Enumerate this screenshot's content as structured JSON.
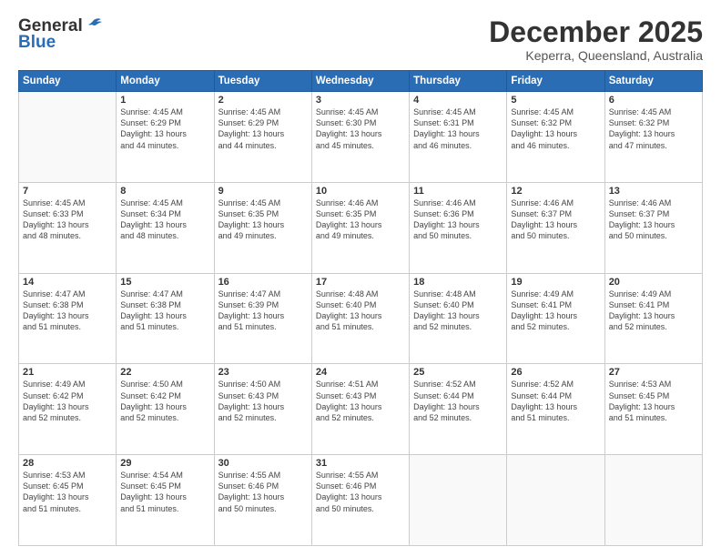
{
  "logo": {
    "line1": "General",
    "line2": "Blue"
  },
  "header": {
    "month": "December 2025",
    "location": "Keperra, Queensland, Australia"
  },
  "days_of_week": [
    "Sunday",
    "Monday",
    "Tuesday",
    "Wednesday",
    "Thursday",
    "Friday",
    "Saturday"
  ],
  "weeks": [
    [
      {
        "day": "",
        "info": ""
      },
      {
        "day": "1",
        "info": "Sunrise: 4:45 AM\nSunset: 6:29 PM\nDaylight: 13 hours\nand 44 minutes."
      },
      {
        "day": "2",
        "info": "Sunrise: 4:45 AM\nSunset: 6:29 PM\nDaylight: 13 hours\nand 44 minutes."
      },
      {
        "day": "3",
        "info": "Sunrise: 4:45 AM\nSunset: 6:30 PM\nDaylight: 13 hours\nand 45 minutes."
      },
      {
        "day": "4",
        "info": "Sunrise: 4:45 AM\nSunset: 6:31 PM\nDaylight: 13 hours\nand 46 minutes."
      },
      {
        "day": "5",
        "info": "Sunrise: 4:45 AM\nSunset: 6:32 PM\nDaylight: 13 hours\nand 46 minutes."
      },
      {
        "day": "6",
        "info": "Sunrise: 4:45 AM\nSunset: 6:32 PM\nDaylight: 13 hours\nand 47 minutes."
      }
    ],
    [
      {
        "day": "7",
        "info": "Sunrise: 4:45 AM\nSunset: 6:33 PM\nDaylight: 13 hours\nand 48 minutes."
      },
      {
        "day": "8",
        "info": "Sunrise: 4:45 AM\nSunset: 6:34 PM\nDaylight: 13 hours\nand 48 minutes."
      },
      {
        "day": "9",
        "info": "Sunrise: 4:45 AM\nSunset: 6:35 PM\nDaylight: 13 hours\nand 49 minutes."
      },
      {
        "day": "10",
        "info": "Sunrise: 4:46 AM\nSunset: 6:35 PM\nDaylight: 13 hours\nand 49 minutes."
      },
      {
        "day": "11",
        "info": "Sunrise: 4:46 AM\nSunset: 6:36 PM\nDaylight: 13 hours\nand 50 minutes."
      },
      {
        "day": "12",
        "info": "Sunrise: 4:46 AM\nSunset: 6:37 PM\nDaylight: 13 hours\nand 50 minutes."
      },
      {
        "day": "13",
        "info": "Sunrise: 4:46 AM\nSunset: 6:37 PM\nDaylight: 13 hours\nand 50 minutes."
      }
    ],
    [
      {
        "day": "14",
        "info": "Sunrise: 4:47 AM\nSunset: 6:38 PM\nDaylight: 13 hours\nand 51 minutes."
      },
      {
        "day": "15",
        "info": "Sunrise: 4:47 AM\nSunset: 6:38 PM\nDaylight: 13 hours\nand 51 minutes."
      },
      {
        "day": "16",
        "info": "Sunrise: 4:47 AM\nSunset: 6:39 PM\nDaylight: 13 hours\nand 51 minutes."
      },
      {
        "day": "17",
        "info": "Sunrise: 4:48 AM\nSunset: 6:40 PM\nDaylight: 13 hours\nand 51 minutes."
      },
      {
        "day": "18",
        "info": "Sunrise: 4:48 AM\nSunset: 6:40 PM\nDaylight: 13 hours\nand 52 minutes."
      },
      {
        "day": "19",
        "info": "Sunrise: 4:49 AM\nSunset: 6:41 PM\nDaylight: 13 hours\nand 52 minutes."
      },
      {
        "day": "20",
        "info": "Sunrise: 4:49 AM\nSunset: 6:41 PM\nDaylight: 13 hours\nand 52 minutes."
      }
    ],
    [
      {
        "day": "21",
        "info": "Sunrise: 4:49 AM\nSunset: 6:42 PM\nDaylight: 13 hours\nand 52 minutes."
      },
      {
        "day": "22",
        "info": "Sunrise: 4:50 AM\nSunset: 6:42 PM\nDaylight: 13 hours\nand 52 minutes."
      },
      {
        "day": "23",
        "info": "Sunrise: 4:50 AM\nSunset: 6:43 PM\nDaylight: 13 hours\nand 52 minutes."
      },
      {
        "day": "24",
        "info": "Sunrise: 4:51 AM\nSunset: 6:43 PM\nDaylight: 13 hours\nand 52 minutes."
      },
      {
        "day": "25",
        "info": "Sunrise: 4:52 AM\nSunset: 6:44 PM\nDaylight: 13 hours\nand 52 minutes."
      },
      {
        "day": "26",
        "info": "Sunrise: 4:52 AM\nSunset: 6:44 PM\nDaylight: 13 hours\nand 51 minutes."
      },
      {
        "day": "27",
        "info": "Sunrise: 4:53 AM\nSunset: 6:45 PM\nDaylight: 13 hours\nand 51 minutes."
      }
    ],
    [
      {
        "day": "28",
        "info": "Sunrise: 4:53 AM\nSunset: 6:45 PM\nDaylight: 13 hours\nand 51 minutes."
      },
      {
        "day": "29",
        "info": "Sunrise: 4:54 AM\nSunset: 6:45 PM\nDaylight: 13 hours\nand 51 minutes."
      },
      {
        "day": "30",
        "info": "Sunrise: 4:55 AM\nSunset: 6:46 PM\nDaylight: 13 hours\nand 50 minutes."
      },
      {
        "day": "31",
        "info": "Sunrise: 4:55 AM\nSunset: 6:46 PM\nDaylight: 13 hours\nand 50 minutes."
      },
      {
        "day": "",
        "info": ""
      },
      {
        "day": "",
        "info": ""
      },
      {
        "day": "",
        "info": ""
      }
    ]
  ]
}
